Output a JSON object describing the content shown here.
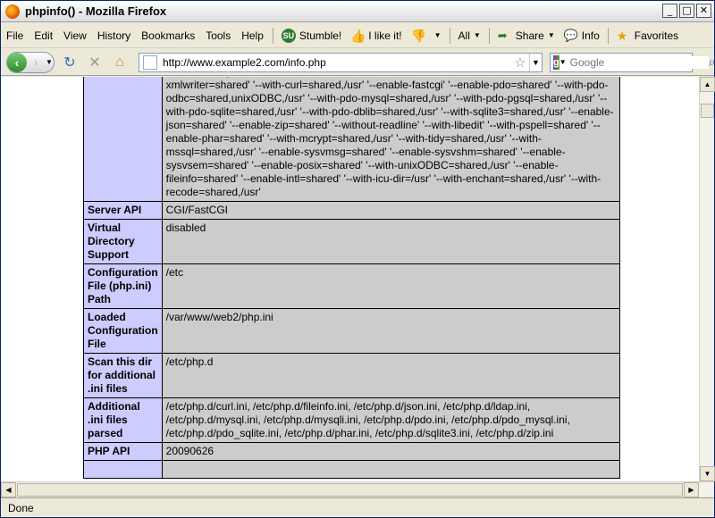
{
  "window": {
    "title": "phpinfo() - Mozilla Firefox",
    "min": "_",
    "max": "□",
    "close": "✕"
  },
  "menu": {
    "items": [
      "File",
      "Edit",
      "View",
      "History",
      "Bookmarks",
      "Tools",
      "Help"
    ],
    "stumble": "Stumble!",
    "ilikeit": "I like it!",
    "all": "All",
    "share": "Share",
    "info": "Info",
    "favorites": "Favorites"
  },
  "nav": {
    "url": "http://www.example2.com/info.php",
    "search_placeholder": "Google"
  },
  "phpinfo": {
    "configure_tail": "--enable-soap=shared' '--with-xsl=shared,/usr' '--enable-xmlreader=shared' '--enable-xmlwriter=shared' '--with-curl=shared,/usr' '--enable-fastcgi' '--enable-pdo=shared' '--with-pdo-odbc=shared,unixODBC,/usr' '--with-pdo-mysql=shared,/usr' '--with-pdo-pgsql=shared,/usr' '--with-pdo-sqlite=shared,/usr' '--with-pdo-dblib=shared,/usr' '--with-sqlite3=shared,/usr' '--enable-json=shared' '--enable-zip=shared' '--without-readline' '--with-libedit' '--with-pspell=shared' '--enable-phar=shared' '--with-mcrypt=shared,/usr' '--with-tidy=shared,/usr' '--with-mssql=shared,/usr' '--enable-sysvmsg=shared' '--enable-sysvshm=shared' '--enable-sysvsem=shared' '--enable-posix=shared' '--with-unixODBC=shared,/usr' '--enable-fileinfo=shared' '--enable-intl=shared' '--with-icu-dir=/usr' '--with-enchant=shared,/usr' '--with-recode=shared,/usr'",
    "rows": [
      {
        "key": "Server API",
        "value": "CGI/FastCGI"
      },
      {
        "key": "Virtual Directory Support",
        "value": "disabled"
      },
      {
        "key": "Configuration File (php.ini) Path",
        "value": "/etc"
      },
      {
        "key": "Loaded Configuration File",
        "value": "/var/www/web2/php.ini"
      },
      {
        "key": "Scan this dir for additional .ini files",
        "value": "/etc/php.d"
      },
      {
        "key": "Additional .ini files parsed",
        "value": "/etc/php.d/curl.ini, /etc/php.d/fileinfo.ini, /etc/php.d/json.ini, /etc/php.d/ldap.ini, /etc/php.d/mysql.ini, /etc/php.d/mysqli.ini, /etc/php.d/pdo.ini, /etc/php.d/pdo_mysql.ini, /etc/php.d/pdo_sqlite.ini, /etc/php.d/phar.ini, /etc/php.d/sqlite3.ini, /etc/php.d/zip.ini"
      },
      {
        "key": "PHP API",
        "value": "20090626"
      }
    ]
  },
  "status": {
    "text": "Done"
  }
}
